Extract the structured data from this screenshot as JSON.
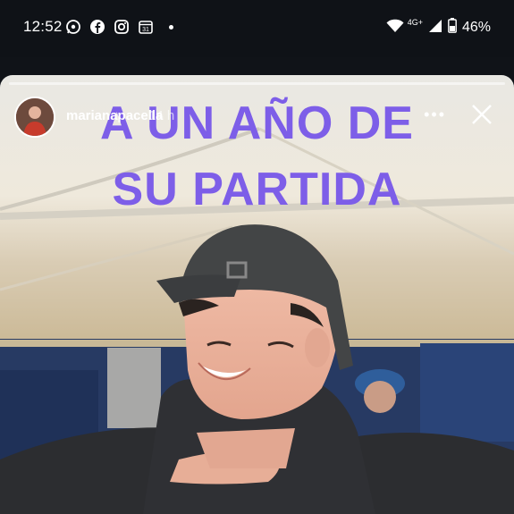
{
  "status_bar": {
    "time": "12:52",
    "network": "4G+",
    "battery": "46%",
    "app_icons": [
      "whatsapp-icon",
      "facebook-icon",
      "instagram-icon",
      "calendar-icon"
    ]
  },
  "story": {
    "username": "marianapacella",
    "time_ago": "14 h",
    "headline_line1": "A UN AÑO DE",
    "headline_line2": "SU PARTIDA",
    "more_label": "•••"
  },
  "colors": {
    "headline": "#7d5ee8",
    "status_bar_bg": "#0f1217"
  }
}
